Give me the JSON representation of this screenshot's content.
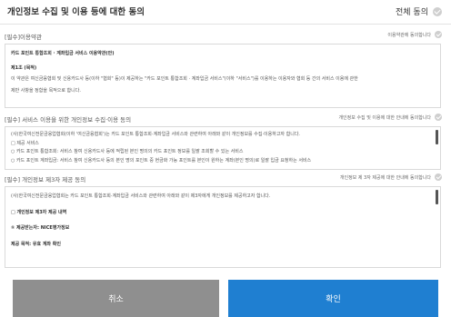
{
  "header": {
    "title": "개인정보 수집 및 이용 등에 대한 동의",
    "all_agree": "전체 동의"
  },
  "sections": [
    {
      "title": "[필수]이용약관",
      "agree_label": "이용약관에 동의합니다",
      "lines": [
        "카드 포인트 통합조회 · 계좌입금 서비스 이용약관(안)",
        "제1조 (목적)",
        "이 약관은 여신금융협회 및 신용카드사 등(이하 \"협회\" 등)이 제공하는 \"카드 포인트 통합조회 · 계좌입금 서비스\"(이하 \"서비스\")를 이용하는 이용자와 협회 등 간의 서비스 이용에 관한",
        "제반 사항을 정함을 목적으로 합니다."
      ]
    },
    {
      "title": "[필수] 서비스 이용을 위한 개인정보 수집·이용 동의",
      "agree_label": "개인정보 수집 및 이용에 대한 안내에 동의합니다",
      "lines": [
        "(사)한국여신전문금융업협회(이하 '여신금융협회')는 카드 포인트 통합조회·계좌입금 서비스와 관련하여 아래와 같이 개인정보를 수집·이용하고자 합니다.",
        "□ 제공 서비스",
        "○ 카드 포인트 통합조회: 서비스 참여 신용카드사 등에 적립된 본인 명의의 카드 포인트 정보를 일괄 조회할 수 있는 서비스",
        "○ 카드 포인트 계좌입금: 서비스 참여 신용카드사 등의 본인 명의 포인트 중 현금화 가능 포인트를 본인이 원하는 계좌(본인 명의)로 일괄 입금 요청하는 서비스"
      ]
    },
    {
      "title": "[필수] 개인정보 제3자 제공 동의",
      "agree_label": "개인정보 제 3자 제공에 대한 안내에 동의합니다",
      "lines": [
        "(사)한국여신전문금융업협회는 카드 포인트 통합조회·계좌입금 서비스와 관련하여 아래와 같이 제3자에게 개인정보를 제공하고자 합니다.",
        "□ 개인정보 제3자 제공 내역",
        "① 제공받는자: NICE평가정보",
        "제공 목적: 유효 계좌 확인"
      ]
    }
  ],
  "buttons": {
    "cancel": "취소",
    "confirm": "확인"
  },
  "colors": {
    "confirm": "#1f7fd1",
    "cancel": "#8f8f8f",
    "check": "#cfcfcf"
  }
}
